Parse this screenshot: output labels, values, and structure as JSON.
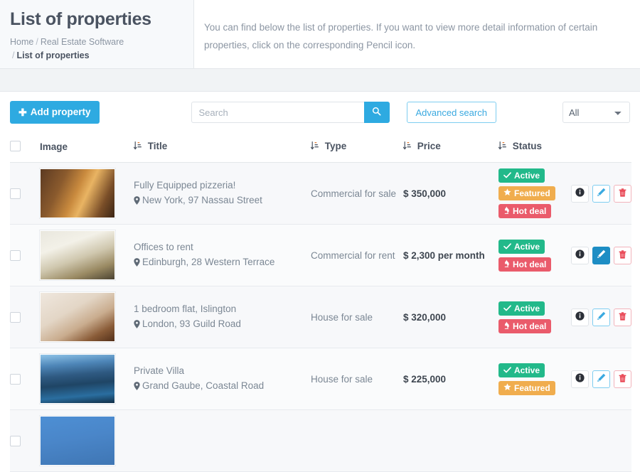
{
  "header": {
    "title": "List of properties",
    "breadcrumb": {
      "home": "Home",
      "section": "Real Estate Software",
      "current": "List of properties",
      "separator": "/"
    },
    "description": "You can find below the list of properties. If you want to view more detail information of certain properties, click on the corresponding Pencil icon."
  },
  "toolbar": {
    "add_label": "Add property",
    "add_icon": "plus-icon",
    "search_placeholder": "Search",
    "search_value": "",
    "search_icon": "search-icon",
    "advanced_label": "Advanced search",
    "filter_selected": "All",
    "filter_options": [
      "All"
    ],
    "filter_icon": "chevron-down-icon"
  },
  "table": {
    "columns": [
      {
        "key": "check",
        "label": "",
        "sortable": false
      },
      {
        "key": "image",
        "label": "Image",
        "sortable": false
      },
      {
        "key": "title",
        "label": "Title",
        "sortable": true
      },
      {
        "key": "type",
        "label": "Type",
        "sortable": true
      },
      {
        "key": "price",
        "label": "Price",
        "sortable": true
      },
      {
        "key": "status",
        "label": "Status",
        "sortable": true
      },
      {
        "key": "act",
        "label": "",
        "sortable": false
      }
    ],
    "sort_icon": "sort-amount-icon",
    "location_icon": "map-pin-icon",
    "actions": {
      "info_icon": "info-circle-icon",
      "edit_icon": "pencil-icon",
      "delete_icon": "trash-icon"
    },
    "rows": [
      {
        "selected": false,
        "image": "pizzeria-interior-photo",
        "title": "Fully Equipped pizzeria!",
        "address": "New York, 97 Nassau Street",
        "type": "Commercial for sale",
        "price": "$ 350,000",
        "badges": [
          {
            "label": "Active",
            "kind": "active",
            "icon": "check-icon",
            "color": "#22b98a"
          },
          {
            "label": "Featured",
            "kind": "featured",
            "icon": "star-icon",
            "color": "#f0ad4e"
          },
          {
            "label": "Hot deal",
            "kind": "hot",
            "icon": "fire-icon",
            "color": "#ea5b6b"
          }
        ],
        "edit_highlighted": false
      },
      {
        "selected": false,
        "image": "office-desk-photo",
        "title": "Offices to rent",
        "address": "Edinburgh, 28 Western Terrace",
        "type": "Commercial for rent",
        "price": "$ 2,300 per month",
        "badges": [
          {
            "label": "Active",
            "kind": "active",
            "icon": "check-icon",
            "color": "#22b98a"
          },
          {
            "label": "Hot deal",
            "kind": "hot",
            "icon": "fire-icon",
            "color": "#ea5b6b"
          }
        ],
        "edit_highlighted": true
      },
      {
        "selected": false,
        "image": "bedroom-flat-photo",
        "title": "1 bedroom flat, Islington",
        "address": "London, 93 Guild Road",
        "type": "House for sale",
        "price": "$ 320,000",
        "badges": [
          {
            "label": "Active",
            "kind": "active",
            "icon": "check-icon",
            "color": "#22b98a"
          },
          {
            "label": "Hot deal",
            "kind": "hot",
            "icon": "fire-icon",
            "color": "#ea5b6b"
          }
        ],
        "edit_highlighted": false
      },
      {
        "selected": false,
        "image": "villa-pool-photo",
        "title": "Private Villa",
        "address": "Grand Gaube, Coastal Road",
        "type": "House for sale",
        "price": "$ 225,000",
        "badges": [
          {
            "label": "Active",
            "kind": "active",
            "icon": "check-icon",
            "color": "#22b98a"
          },
          {
            "label": "Featured",
            "kind": "featured",
            "icon": "star-icon",
            "color": "#f0ad4e"
          }
        ],
        "edit_highlighted": false
      },
      {
        "selected": false,
        "image": "blue-exterior-photo",
        "title": "",
        "address": "",
        "type": "",
        "price": "",
        "badges": [],
        "edit_highlighted": false
      }
    ]
  },
  "colors": {
    "accent": "#2eaae1",
    "active": "#22b98a",
    "featured": "#f0ad4e",
    "hot": "#ea5b6b",
    "header_bg": "#f7f9fb",
    "band_bg": "#f1f3f5"
  }
}
